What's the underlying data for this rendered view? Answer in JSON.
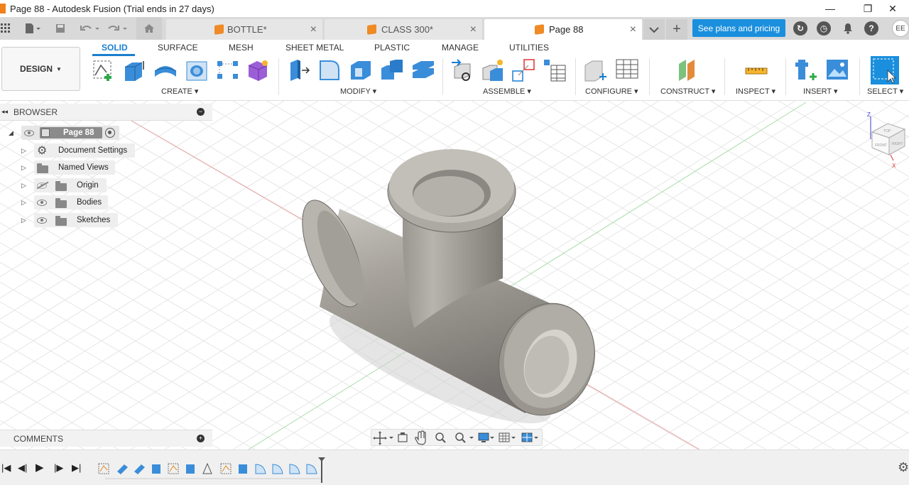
{
  "window": {
    "title": "Page 88 - Autodesk Fusion (Trial ends in 27 days)",
    "minimize_icon": "minimize-icon",
    "maximize_icon": "restore-icon",
    "close_icon": "close-icon"
  },
  "tabbar": {
    "tabs": [
      {
        "label": "BOTTLE*",
        "active": false
      },
      {
        "label": "CLASS 300*",
        "active": false
      },
      {
        "label": "Page 88",
        "active": true
      }
    ],
    "plans_button": "See plans and pricing",
    "user_initials": "EE"
  },
  "toolbar": {
    "workspace": "DESIGN",
    "workspace_tabs": [
      "SOLID",
      "SURFACE",
      "MESH",
      "SHEET METAL",
      "PLASTIC",
      "MANAGE",
      "UTILITIES"
    ],
    "active_tab": "SOLID",
    "groups": {
      "create": "CREATE",
      "modify": "MODIFY",
      "assemble": "ASSEMBLE",
      "configure": "CONFIGURE",
      "construct": "CONSTRUCT",
      "inspect": "INSPECT",
      "insert": "INSERT",
      "select": "SELECT"
    }
  },
  "browser": {
    "header": "BROWSER",
    "root": "Page 88",
    "items": [
      "Document Settings",
      "Named Views",
      "Origin",
      "Bodies",
      "Sketches"
    ]
  },
  "comments": {
    "header": "COMMENTS"
  },
  "viewcube": {
    "top": "TOP",
    "front": "FRONT",
    "right": "RIGHT",
    "axis_z": "Z",
    "axis_x": "X"
  },
  "colors": {
    "accent": "#1a7fd0",
    "plans_button": "#1a8fdd",
    "tab_cube": "#f08a24",
    "model_metal": "#a09c94"
  }
}
